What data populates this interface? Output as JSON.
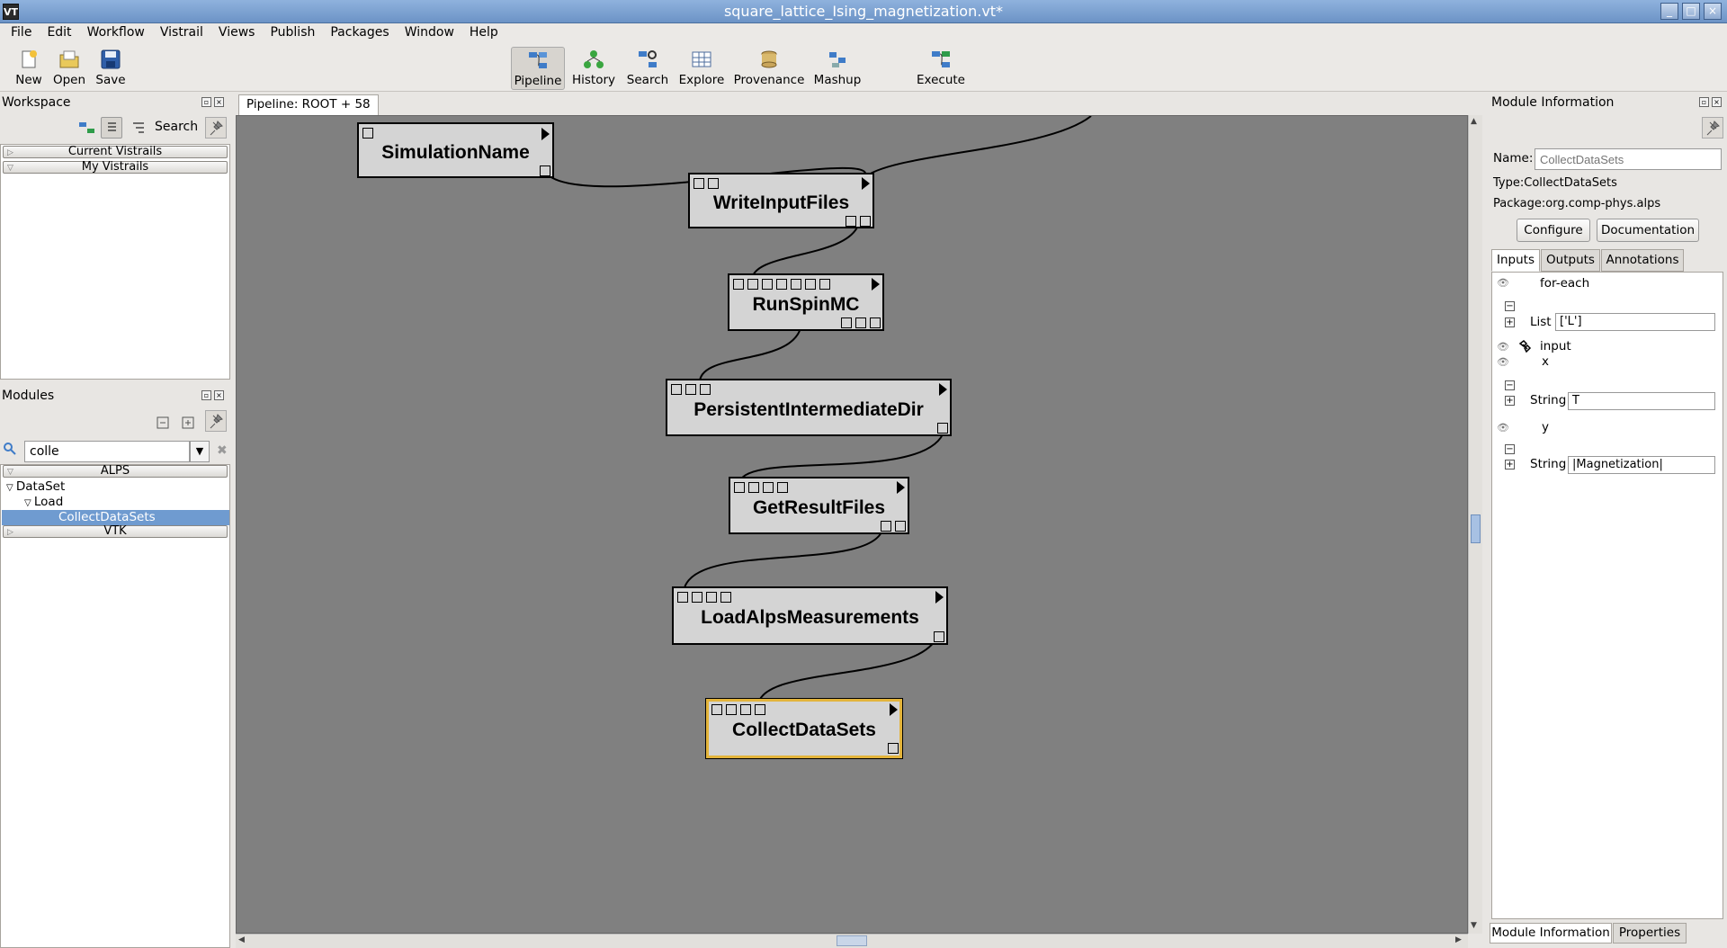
{
  "window": {
    "title": "square_lattice_Ising_magnetization.vt*",
    "app_icon": "VT"
  },
  "menu": [
    "File",
    "Edit",
    "Workflow",
    "Vistrail",
    "Views",
    "Publish",
    "Packages",
    "Window",
    "Help"
  ],
  "toolbar": {
    "file": [
      {
        "label": "New",
        "icon": "new-file-icon"
      },
      {
        "label": "Open",
        "icon": "open-folder-icon"
      },
      {
        "label": "Save",
        "icon": "save-disk-icon"
      }
    ],
    "views": [
      {
        "label": "Pipeline",
        "icon": "pipeline-icon",
        "active": true
      },
      {
        "label": "History",
        "icon": "history-icon"
      },
      {
        "label": "Search",
        "icon": "search-icon"
      },
      {
        "label": "Explore",
        "icon": "explore-icon"
      },
      {
        "label": "Provenance",
        "icon": "provenance-icon"
      },
      {
        "label": "Mashup",
        "icon": "mashup-icon"
      }
    ],
    "execute": {
      "label": "Execute",
      "icon": "execute-icon"
    }
  },
  "workspace": {
    "title": "Workspace",
    "search_label": "Search",
    "sections": [
      "Current Vistrails",
      "My Vistrails"
    ]
  },
  "modules_panel": {
    "title": "Modules",
    "search_value": "colle",
    "sections": [
      "ALPS",
      "VTK"
    ],
    "tree": {
      "dataset": "DataSet",
      "load": "Load",
      "selected": "CollectDataSets"
    }
  },
  "pipeline": {
    "tab_label": "Pipeline: ROOT + 58",
    "modules": [
      {
        "name": "SimulationName"
      },
      {
        "name": "WriteInputFiles"
      },
      {
        "name": "RunSpinMC"
      },
      {
        "name": "PersistentIntermediateDir"
      },
      {
        "name": "GetResultFiles"
      },
      {
        "name": "LoadAlpsMeasurements"
      },
      {
        "name": "CollectDataSets",
        "selected": true
      }
    ]
  },
  "module_info": {
    "title": "Module Information",
    "name_label": "Name:",
    "name_placeholder": "CollectDataSets",
    "type_label": "Type:",
    "type_value": "CollectDataSets",
    "package_label": "Package:",
    "package_value": "org.comp-phys.alps",
    "configure_label": "Configure",
    "documentation_label": "Documentation",
    "tabs": [
      "Inputs",
      "Outputs",
      "Annotations"
    ],
    "inputs": {
      "for_each": "for-each",
      "list_label": "List",
      "list_value": "['L']",
      "input": "input",
      "x": "x",
      "x_type": "String",
      "x_value": "T",
      "y": "y",
      "y_type": "String",
      "y_value": "|Magnetization|"
    },
    "bottom_tabs": [
      "Module Information",
      "Properties"
    ]
  },
  "colors": {
    "title_bar": "#7ea3d4",
    "canvas": "#808080",
    "module_fill": "#d4d4d4",
    "selected_module_border": "#e3b43b",
    "selection": "#6f9bd0"
  }
}
